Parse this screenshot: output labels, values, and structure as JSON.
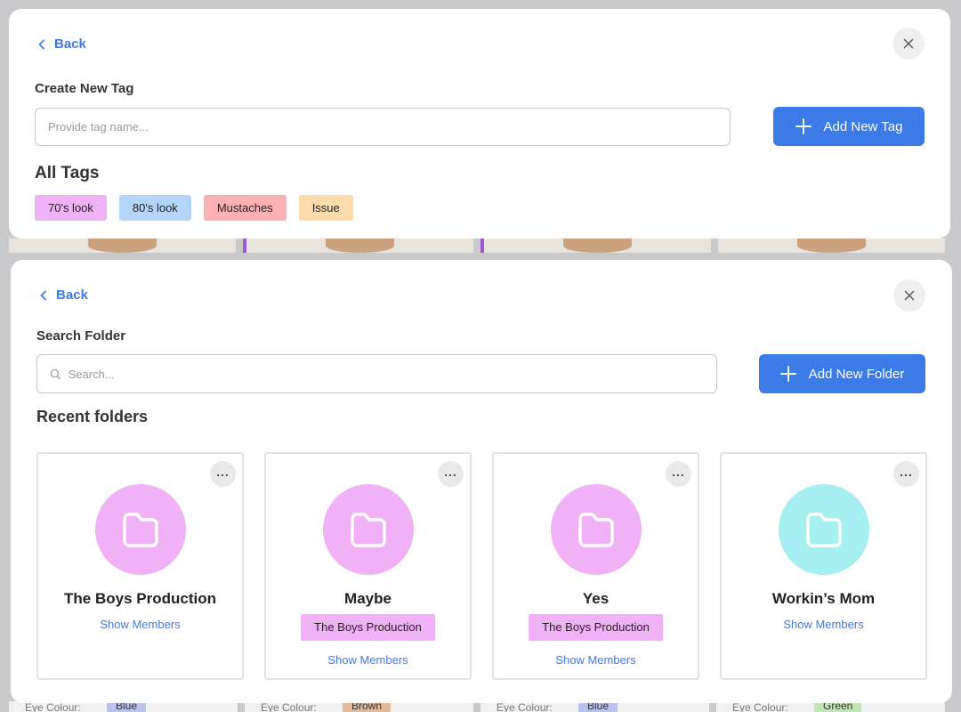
{
  "background": {
    "eye_label": "Eye Colour:",
    "eye_values": [
      {
        "value": "Blue",
        "color": "#b9c3ea"
      },
      {
        "value": "Brown",
        "color": "#e0b99a"
      },
      {
        "value": "Blue",
        "color": "#b9c3ea"
      },
      {
        "value": "Green",
        "color": "#bfe6b4"
      }
    ]
  },
  "tag_modal": {
    "back_label": "Back",
    "create_label": "Create New Tag",
    "input_placeholder": "Provide tag name...",
    "add_button_label": "Add New Tag",
    "all_tags_heading": "All Tags",
    "tags": [
      {
        "label": "70's look",
        "color": "#f1b1f7"
      },
      {
        "label": "80's look",
        "color": "#b4d4fb"
      },
      {
        "label": "Mustaches",
        "color": "#fbb1b1"
      },
      {
        "label": "Issue",
        "color": "#fcdcae"
      }
    ]
  },
  "folder_modal": {
    "back_label": "Back",
    "search_label": "Search Folder",
    "search_placeholder": "Search...",
    "add_button_label": "Add New Folder",
    "recent_heading": "Recent folders",
    "more_glyph": "...",
    "folders": [
      {
        "name": "The Boys Production",
        "badge": "",
        "show_members": "Show Members",
        "color": "#f1b1f7"
      },
      {
        "name": "Maybe",
        "badge": "The Boys Production",
        "show_members": "Show Members",
        "color": "#f1b1f7"
      },
      {
        "name": "Yes",
        "badge": "The Boys Production",
        "show_members": "Show Members",
        "color": "#f1b1f7"
      },
      {
        "name": "Workin’s Mom",
        "badge": "",
        "show_members": "Show Members",
        "color": "#a5eef2"
      }
    ]
  },
  "colors": {
    "accent": "#3b7be8"
  }
}
